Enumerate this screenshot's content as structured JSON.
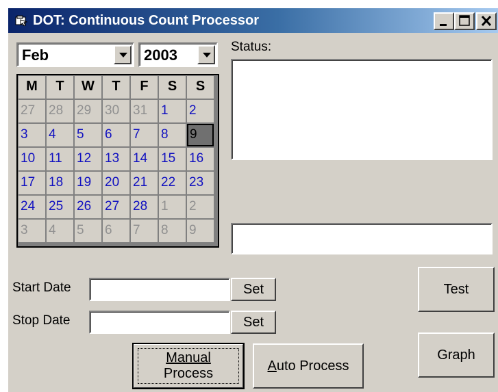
{
  "window": {
    "title": "DOT: Continuous Count Processor"
  },
  "calendar": {
    "month": "Feb",
    "year": "2003",
    "weekdays": [
      "M",
      "T",
      "W",
      "T",
      "F",
      "S",
      "S"
    ],
    "weeks": [
      [
        "27",
        "28",
        "29",
        "30",
        "31",
        "1",
        "2"
      ],
      [
        "3",
        "4",
        "5",
        "6",
        "7",
        "8",
        "9"
      ],
      [
        "10",
        "11",
        "12",
        "13",
        "14",
        "15",
        "16"
      ],
      [
        "17",
        "18",
        "19",
        "20",
        "21",
        "22",
        "23"
      ],
      [
        "24",
        "25",
        "26",
        "27",
        "28",
        "1",
        "2"
      ],
      [
        "3",
        "4",
        "5",
        "6",
        "7",
        "8",
        "9"
      ]
    ],
    "selected_day": "9",
    "colors": {
      "current_month": "#1010c0",
      "other_month": "#909090",
      "selected_bg": "#707070"
    }
  },
  "status": {
    "label": "Status:",
    "text": "",
    "line": ""
  },
  "dates": {
    "start_label": "Start Date",
    "start_value": "",
    "stop_label": "Stop Date",
    "stop_value": "",
    "set_label": "Set"
  },
  "buttons": {
    "manual_process_line1": "Manual",
    "manual_process_line2": "Process",
    "auto_process_prefix": "A",
    "auto_process_rest": "uto Process",
    "test": "Test",
    "graph": "Graph"
  }
}
